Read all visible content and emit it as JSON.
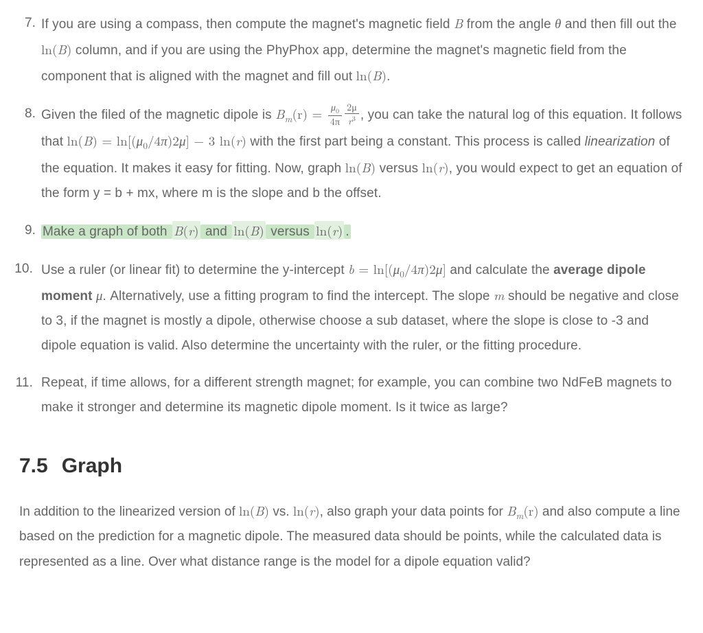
{
  "items": {
    "i7": {
      "t1": "If you are using a compass, then compute the magnet's magnetic field ",
      "m1": "B",
      "t2": " from the angle ",
      "m2": "θ",
      "t3": " and then fill out the ",
      "m3": "ln(B)",
      "t4": " column, and if you are using the PhyPhox app, determine the magnet's magnetic field from the component that is aligned with the magnet and fill out ",
      "m4": "ln(B)",
      "t5": "."
    },
    "i8": {
      "t1": "Given the filed of the magnetic dipole is ",
      "t2": ", you can take the natural log of this equation. It follows that ",
      "m2": "ln(B) = ln[(μ",
      "m2b": "/4π)2μ] − 3 ln(r)",
      "t3": " with the first part being a constant. This process is called ",
      "em": "linearization",
      "t4": " of the equation. It makes it easy for fitting. Now, graph ",
      "m3": "ln(B)",
      "t5": " versus ",
      "m4": "ln(r)",
      "t6": ", you would expect to get an equation of the form y = b + mx, where m is the slope and b the offset.",
      "bm_lhs_B": "B",
      "bm_lhs_m": "m",
      "bm_lhs_r": "(r) = ",
      "frac1_num_mu": "μ",
      "frac1_num_0": "0",
      "frac1_den": "4π",
      "frac2_num_2mu": "2μ",
      "frac2_den_r": "r",
      "frac2_den_3": "3",
      "mu_sub0": "0"
    },
    "i9": {
      "t1": "Make a graph of both ",
      "m1": "B(r)",
      "t2": " and ",
      "m2": "ln(B)",
      "t3": " versus ",
      "m3": "ln(r)",
      "t4": "."
    },
    "i10": {
      "t1": "Use a ruler (or linear fit) to determine the y-intercept ",
      "m1a": "b = ln[(μ",
      "m1_sub": "0",
      "m1b": "/4π)2μ]",
      "t2": " and calculate the ",
      "b1": "average dipole moment ",
      "m2": "μ",
      "t3": ". Alternatively, use a fitting program to find the intercept. The slope ",
      "m3": "m",
      "t4": " should be negative and close to 3, if the magnet is mostly a dipole, otherwise choose a sub dataset, where the slope is close to -3 and dipole equation is valid. Also determine the uncertainty with the ruler, or the fitting procedure."
    },
    "i11": {
      "t1": "Repeat, if time allows, for a different strength magnet; for example, you can combine two NdFeB magnets to make it stronger and determine its magnetic dipole moment. Is it twice as large?"
    }
  },
  "section": {
    "number": "7.5",
    "title": "Graph"
  },
  "graph_para": {
    "t1": "In addition to the linearized version of ",
    "m1": "ln(B)",
    "t2": " vs. ",
    "m2": "ln(r)",
    "t3": ", also graph your data points for ",
    "m3_B": "B",
    "m3_m": "m",
    "m3_r": "(r)",
    "t4": " and also compute a line based on the prediction for a magnetic dipole. The measured data should be points, while the calculated data is represented as a line. Over what distance range is the model for a dipole equation valid?"
  }
}
